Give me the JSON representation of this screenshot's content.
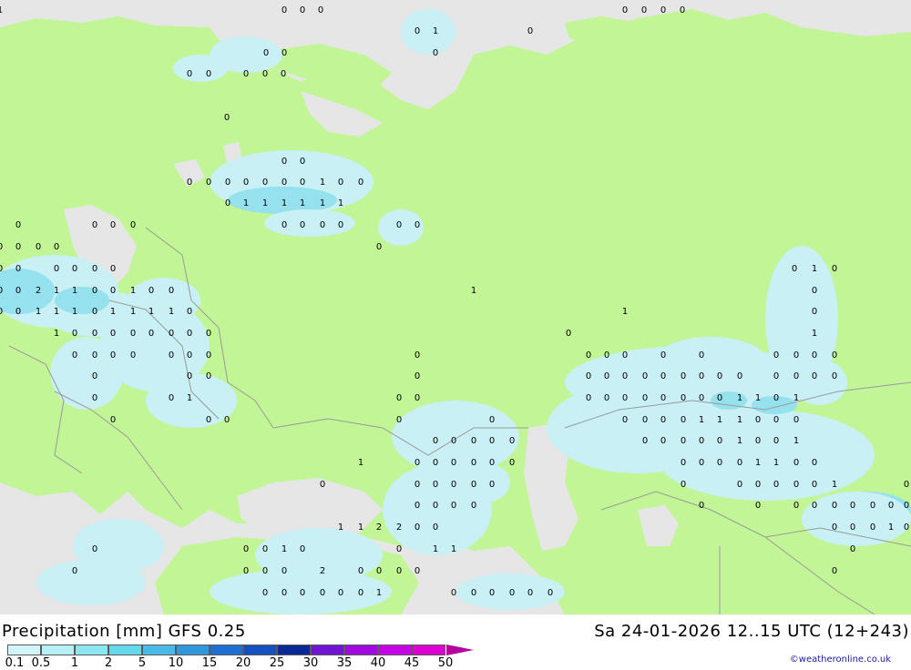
{
  "header": {
    "title": "Precipitation [mm] GFS 0.25",
    "datetime": "Sa 24-01-2026 12..15 UTC (12+243)"
  },
  "credit": "©weatheronline.co.uk",
  "legend": {
    "labels": [
      "0.1",
      "0.5",
      "1",
      "2",
      "5",
      "10",
      "15",
      "20",
      "25",
      "30",
      "35",
      "40",
      "45",
      "50"
    ],
    "colors": [
      "#d2f5fa",
      "#b4f0f5",
      "#8ce6f0",
      "#64d7eb",
      "#4bb9e6",
      "#3296dc",
      "#1e6ed2",
      "#1450be",
      "#0a2896",
      "#6e14d2",
      "#a00ae1",
      "#c800e6",
      "#dc00d2",
      "#b400a0"
    ]
  },
  "map_colors": {
    "land": "#c2f596",
    "sea": "#e6e6e6",
    "precip_light": "#c8f0f5",
    "precip_medium": "#96e1ee",
    "precip_heavy": "#78d2ea",
    "border": "#9a9a9a"
  },
  "map_values": [
    {
      "v": "0"
    },
    {
      "v": "0"
    },
    {
      "v": "0"
    },
    {
      "v": "1"
    },
    {
      "v": "0"
    },
    {
      "v": "0"
    },
    {
      "v": "0"
    },
    {
      "v": "0"
    },
    {
      "v": "0"
    },
    {
      "v": "1"
    },
    {
      "v": "0"
    },
    {
      "v": "0"
    },
    {
      "v": "0"
    },
    {
      "v": "0"
    },
    {
      "v": "0"
    },
    {
      "v": "0"
    },
    {
      "v": "0"
    },
    {
      "v": "0"
    },
    {
      "v": "0"
    },
    {
      "v": "0"
    },
    {
      "v": "0"
    },
    {
      "v": "0"
    },
    {
      "v": "0"
    },
    {
      "v": "0"
    },
    {
      "v": "0"
    },
    {
      "v": "0"
    },
    {
      "v": "0"
    },
    {
      "v": "0"
    },
    {
      "v": "0"
    },
    {
      "v": "1"
    },
    {
      "v": "0"
    },
    {
      "v": "0"
    },
    {
      "v": "0"
    },
    {
      "v": "1"
    },
    {
      "v": "1"
    },
    {
      "v": "1"
    },
    {
      "v": "1"
    },
    {
      "v": "1"
    },
    {
      "v": "1"
    },
    {
      "v": "0"
    },
    {
      "v": "0"
    },
    {
      "v": "0"
    },
    {
      "v": "0"
    },
    {
      "v": "0"
    },
    {
      "v": "0"
    },
    {
      "v": "0"
    },
    {
      "v": "0"
    },
    {
      "v": "0"
    },
    {
      "v": "0"
    },
    {
      "v": "0"
    },
    {
      "v": "0"
    },
    {
      "v": "0"
    },
    {
      "v": "0"
    },
    {
      "v": "0"
    },
    {
      "v": "0"
    },
    {
      "v": "0"
    },
    {
      "v": "0"
    },
    {
      "v": "0"
    },
    {
      "v": "0"
    },
    {
      "v": "0"
    },
    {
      "v": "0"
    },
    {
      "v": "1"
    },
    {
      "v": "0"
    },
    {
      "v": "0"
    },
    {
      "v": "0"
    },
    {
      "v": "2"
    },
    {
      "v": "1"
    },
    {
      "v": "1"
    },
    {
      "v": "0"
    },
    {
      "v": "0"
    },
    {
      "v": "1"
    },
    {
      "v": "0"
    },
    {
      "v": "0"
    },
    {
      "v": "1"
    },
    {
      "v": "0"
    },
    {
      "v": "0"
    },
    {
      "v": "0"
    },
    {
      "v": "1"
    },
    {
      "v": "1"
    },
    {
      "v": "1"
    },
    {
      "v": "0"
    },
    {
      "v": "1"
    },
    {
      "v": "1"
    },
    {
      "v": "1"
    },
    {
      "v": "1"
    },
    {
      "v": "0"
    },
    {
      "v": "1"
    },
    {
      "v": "1"
    },
    {
      "v": "0"
    },
    {
      "v": "0"
    },
    {
      "v": "0"
    },
    {
      "v": "0"
    },
    {
      "v": "0"
    },
    {
      "v": "0"
    },
    {
      "v": "0"
    },
    {
      "v": "0"
    },
    {
      "v": "0"
    },
    {
      "v": "0"
    },
    {
      "v": "1"
    },
    {
      "v": "0"
    },
    {
      "v": "0"
    },
    {
      "v": "0"
    },
    {
      "v": "0"
    },
    {
      "v": "0"
    },
    {
      "v": "0"
    },
    {
      "v": "0"
    },
    {
      "v": "0"
    },
    {
      "v": "0"
    },
    {
      "v": "0"
    },
    {
      "v": "0"
    },
    {
      "v": "0"
    },
    {
      "v": "0"
    },
    {
      "v": "0"
    },
    {
      "v": "0"
    },
    {
      "v": "0"
    },
    {
      "v": "0"
    },
    {
      "v": "0"
    },
    {
      "v": "0"
    },
    {
      "v": "0"
    },
    {
      "v": "0"
    },
    {
      "v": "0"
    },
    {
      "v": "0"
    },
    {
      "v": "0"
    },
    {
      "v": "0"
    },
    {
      "v": "0"
    },
    {
      "v": "0"
    },
    {
      "v": "0"
    },
    {
      "v": "0"
    },
    {
      "v": "0"
    },
    {
      "v": "0"
    },
    {
      "v": "0"
    },
    {
      "v": "0"
    },
    {
      "v": "0"
    },
    {
      "v": "0"
    },
    {
      "v": "0"
    },
    {
      "v": "1"
    },
    {
      "v": "0"
    },
    {
      "v": "0"
    },
    {
      "v": "0"
    },
    {
      "v": "0"
    },
    {
      "v": "0"
    },
    {
      "v": "0"
    },
    {
      "v": "0"
    },
    {
      "v": "0"
    },
    {
      "v": "0"
    },
    {
      "v": "0"
    },
    {
      "v": "1"
    },
    {
      "v": "1"
    },
    {
      "v": "0"
    },
    {
      "v": "1"
    },
    {
      "v": "0"
    },
    {
      "v": "0"
    },
    {
      "v": "0"
    },
    {
      "v": "0"
    },
    {
      "v": "0"
    },
    {
      "v": "0"
    },
    {
      "v": "0"
    },
    {
      "v": "0"
    },
    {
      "v": "0"
    },
    {
      "v": "1"
    },
    {
      "v": "1"
    },
    {
      "v": "1"
    },
    {
      "v": "0"
    },
    {
      "v": "0"
    },
    {
      "v": "0"
    },
    {
      "v": "0"
    },
    {
      "v": "0"
    },
    {
      "v": "0"
    },
    {
      "v": "0"
    },
    {
      "v": "0"
    },
    {
      "v": "0"
    },
    {
      "v": "0"
    },
    {
      "v": "0"
    },
    {
      "v": "0"
    },
    {
      "v": "0"
    },
    {
      "v": "1"
    },
    {
      "v": "0"
    },
    {
      "v": "0"
    },
    {
      "v": "1"
    },
    {
      "v": "1"
    },
    {
      "v": "0"
    },
    {
      "v": "0"
    },
    {
      "v": "0"
    },
    {
      "v": "0"
    },
    {
      "v": "0"
    },
    {
      "v": "0"
    },
    {
      "v": "0"
    },
    {
      "v": "0"
    },
    {
      "v": "0"
    },
    {
      "v": "0"
    },
    {
      "v": "1"
    },
    {
      "v": "1"
    },
    {
      "v": "0"
    },
    {
      "v": "0"
    },
    {
      "v": "0"
    },
    {
      "v": "0"
    },
    {
      "v": "0"
    },
    {
      "v": "0"
    },
    {
      "v": "0"
    },
    {
      "v": "0"
    },
    {
      "v": "0"
    },
    {
      "v": "0"
    },
    {
      "v": "0"
    },
    {
      "v": "0"
    },
    {
      "v": "0"
    },
    {
      "v": "0"
    },
    {
      "v": "1"
    },
    {
      "v": "0"
    },
    {
      "v": "0"
    },
    {
      "v": "0"
    },
    {
      "v": "0"
    },
    {
      "v": "0"
    },
    {
      "v": "0"
    },
    {
      "v": "0"
    },
    {
      "v": "0"
    },
    {
      "v": "0"
    },
    {
      "v": "0"
    },
    {
      "v": "0"
    },
    {
      "v": "0"
    },
    {
      "v": "0"
    },
    {
      "v": "0"
    },
    {
      "v": "1"
    },
    {
      "v": "1"
    },
    {
      "v": "2"
    },
    {
      "v": "2"
    },
    {
      "v": "0"
    },
    {
      "v": "0"
    },
    {
      "v": "0"
    },
    {
      "v": "0"
    },
    {
      "v": "0"
    },
    {
      "v": "1"
    },
    {
      "v": "0"
    },
    {
      "v": "0"
    },
    {
      "v": "0"
    },
    {
      "v": "0"
    },
    {
      "v": "1"
    },
    {
      "v": "0"
    },
    {
      "v": "0"
    },
    {
      "v": "1"
    },
    {
      "v": "1"
    },
    {
      "v": "0"
    },
    {
      "v": "0"
    },
    {
      "v": "0"
    },
    {
      "v": "0"
    },
    {
      "v": "0"
    },
    {
      "v": "2"
    },
    {
      "v": "0"
    },
    {
      "v": "0"
    },
    {
      "v": "0"
    },
    {
      "v": "0"
    },
    {
      "v": "0"
    },
    {
      "v": "0"
    },
    {
      "v": "0"
    },
    {
      "v": "0"
    },
    {
      "v": "0"
    },
    {
      "v": "0"
    },
    {
      "v": "0"
    },
    {
      "v": "1"
    },
    {
      "v": "0"
    },
    {
      "v": "0"
    },
    {
      "v": "0"
    },
    {
      "v": "0"
    },
    {
      "v": "0"
    },
    {
      "v": "0"
    }
  ]
}
